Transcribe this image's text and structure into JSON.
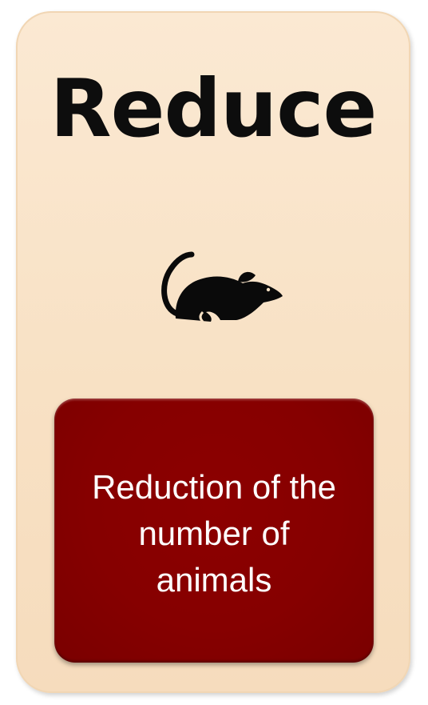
{
  "card": {
    "title": "Reduce",
    "icon": "mouse-icon",
    "description": "Reduction of the number of animals"
  },
  "colors": {
    "card_background": "#f8e1c4",
    "title_text": "#0d0d0d",
    "box_background": "#880000",
    "box_text": "#ffffff"
  }
}
